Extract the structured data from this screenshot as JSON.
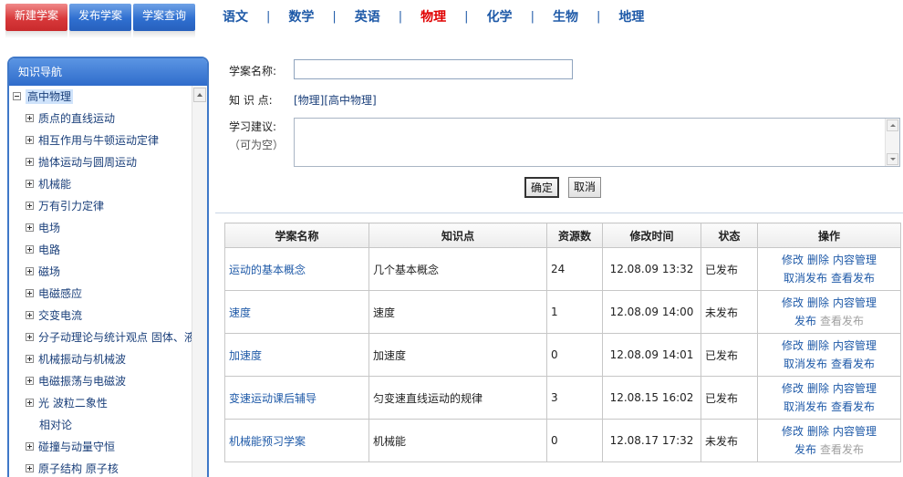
{
  "top_buttons": [
    {
      "label": "新建学案"
    },
    {
      "label": "发布学案"
    },
    {
      "label": "学案查询"
    }
  ],
  "subjects": [
    {
      "label": "语文",
      "active": false
    },
    {
      "label": "数学",
      "active": false
    },
    {
      "label": "英语",
      "active": false
    },
    {
      "label": "物理",
      "active": true
    },
    {
      "label": "化学",
      "active": false
    },
    {
      "label": "生物",
      "active": false
    },
    {
      "label": "地理",
      "active": false
    }
  ],
  "subject_separator": "|",
  "sidebar": {
    "title": "知识导航",
    "root": "高中物理",
    "items": [
      {
        "label": "质点的直线运动",
        "expandable": true
      },
      {
        "label": "相互作用与牛顿运动定律",
        "expandable": true
      },
      {
        "label": "抛体运动与圆周运动",
        "expandable": true
      },
      {
        "label": "机械能",
        "expandable": true
      },
      {
        "label": "万有引力定律",
        "expandable": true
      },
      {
        "label": "电场",
        "expandable": true
      },
      {
        "label": "电路",
        "expandable": true
      },
      {
        "label": "磁场",
        "expandable": true
      },
      {
        "label": "电磁感应",
        "expandable": true
      },
      {
        "label": "交变电流",
        "expandable": true
      },
      {
        "label": "分子动理论与统计观点 固体、液",
        "expandable": true
      },
      {
        "label": "机械振动与机械波",
        "expandable": true
      },
      {
        "label": "电磁振荡与电磁波",
        "expandable": true
      },
      {
        "label": "光 波粒二象性",
        "expandable": true
      },
      {
        "label": "相对论",
        "expandable": false
      },
      {
        "label": "碰撞与动量守恒",
        "expandable": true
      },
      {
        "label": "原子结构 原子核",
        "expandable": true
      }
    ]
  },
  "form": {
    "name_label": "学案名称:",
    "name_value": "",
    "kp_label": "知 识 点:",
    "kp_value": "[物理][高中物理]",
    "advice_label": "学习建议:",
    "advice_hint": "（可为空）",
    "advice_value": "",
    "ok_label": "确定",
    "cancel_label": "取消"
  },
  "table": {
    "headers": [
      "学案名称",
      "知识点",
      "资源数",
      "修改时间",
      "状态",
      "操作"
    ],
    "rows": [
      {
        "name": "运动的基本概念",
        "knowledge": "几个基本概念",
        "resources": "24",
        "modified": "12.08.09 13:32",
        "status": "已发布",
        "ops": [
          "修改",
          "删除",
          "内容管理",
          "取消发布",
          "查看发布"
        ],
        "disabled": []
      },
      {
        "name": "速度",
        "knowledge": "速度",
        "resources": "1",
        "modified": "12.08.09 14:00",
        "status": "未发布",
        "ops": [
          "修改",
          "删除",
          "内容管理",
          "发布",
          "查看发布"
        ],
        "disabled": [
          4
        ]
      },
      {
        "name": "加速度",
        "knowledge": "加速度",
        "resources": "0",
        "modified": "12.08.09 14:01",
        "status": "已发布",
        "ops": [
          "修改",
          "删除",
          "内容管理",
          "取消发布",
          "查看发布"
        ],
        "disabled": []
      },
      {
        "name": "变速运动课后辅导",
        "knowledge": "匀变速直线运动的规律",
        "resources": "3",
        "modified": "12.08.15 16:02",
        "status": "已发布",
        "ops": [
          "修改",
          "删除",
          "内容管理",
          "取消发布",
          "查看发布"
        ],
        "disabled": []
      },
      {
        "name": "机械能预习学案",
        "knowledge": "机械能",
        "resources": "0",
        "modified": "12.08.17 17:32",
        "status": "未发布",
        "ops": [
          "修改",
          "删除",
          "内容管理",
          "发布",
          "查看发布"
        ],
        "disabled": [
          4
        ]
      }
    ]
  },
  "colors": {
    "accent_blue": "#1f5aa8",
    "active_red": "#e00000",
    "panel_border": "#3f78c8"
  }
}
